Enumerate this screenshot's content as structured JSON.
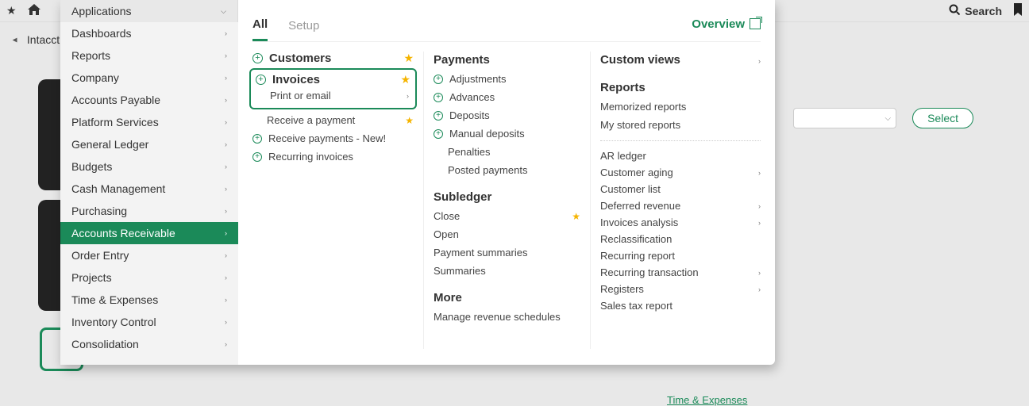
{
  "topbar": {
    "search_label": "Search"
  },
  "background": {
    "breadcrumb": "Intacct",
    "select_button": "Select",
    "bottom_link": "Time & Expenses"
  },
  "menu": {
    "trigger": "Applications",
    "side_items": [
      "Dashboards",
      "Reports",
      "Company",
      "Accounts Payable",
      "Platform Services",
      "General Ledger",
      "Budgets",
      "Cash Management",
      "Purchasing",
      "Accounts Receivable",
      "Order Entry",
      "Projects",
      "Time & Expenses",
      "Inventory Control",
      "Consolidation"
    ],
    "tabs": {
      "all": "All",
      "setup": "Setup"
    },
    "overview": "Overview",
    "col1": {
      "customers": "Customers",
      "invoices": "Invoices",
      "print_email": "Print or email",
      "receive_payment": "Receive a payment",
      "receive_payments_new": "Receive payments - New!",
      "recurring_invoices": "Recurring invoices"
    },
    "col2": {
      "payments": "Payments",
      "adjustments": "Adjustments",
      "advances": "Advances",
      "deposits": "Deposits",
      "manual_deposits": "Manual deposits",
      "penalties": "Penalties",
      "posted_payments": "Posted payments",
      "subledger": "Subledger",
      "close": "Close",
      "open": "Open",
      "payment_summaries": "Payment summaries",
      "summaries": "Summaries",
      "more": "More",
      "manage_rev": "Manage revenue schedules"
    },
    "col3": {
      "custom_views": "Custom views",
      "reports": "Reports",
      "memorized": "Memorized reports",
      "my_stored": "My stored reports",
      "ar_ledger": "AR ledger",
      "customer_aging": "Customer aging",
      "customer_list": "Customer list",
      "deferred_rev": "Deferred revenue",
      "inv_analysis": "Invoices analysis",
      "reclass": "Reclassification",
      "recurring_report": "Recurring report",
      "recurring_txn": "Recurring transaction",
      "registers": "Registers",
      "sales_tax": "Sales tax report"
    }
  }
}
